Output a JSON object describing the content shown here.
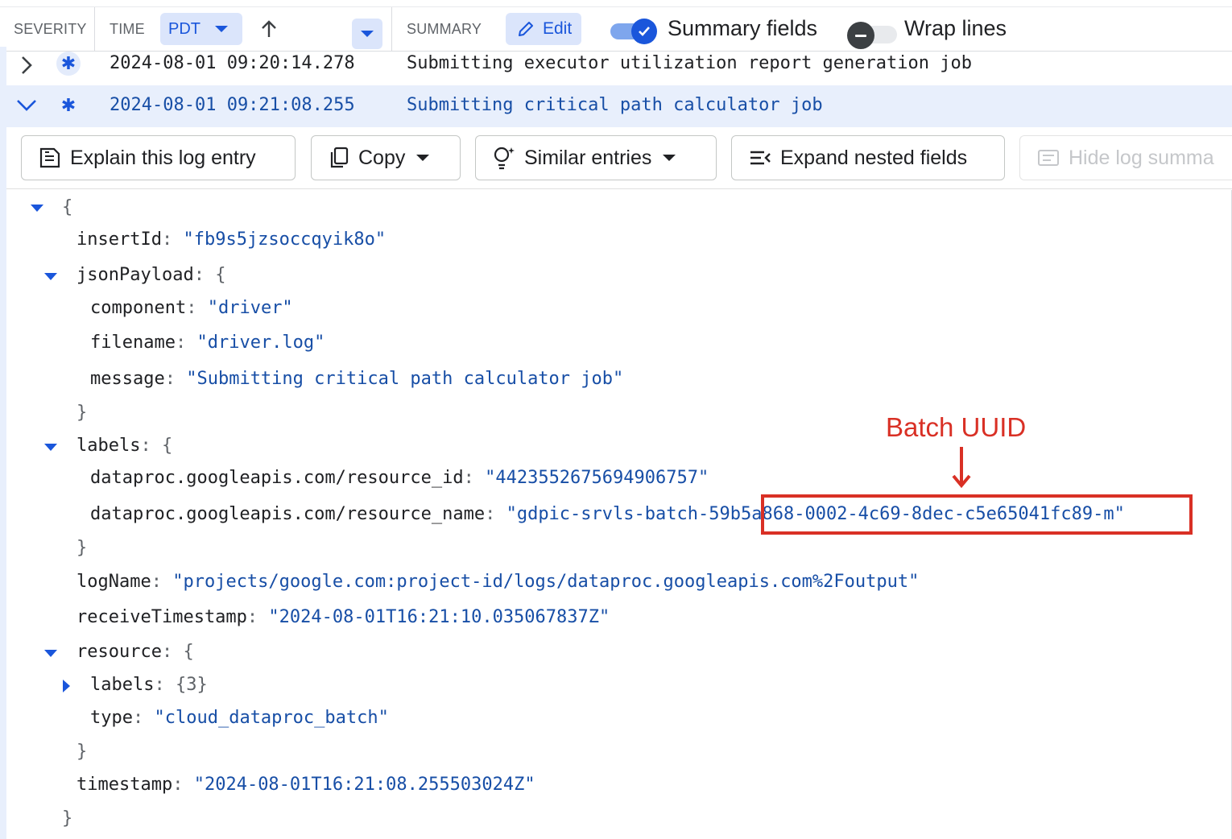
{
  "header": {
    "severity": "SEVERITY",
    "time": "TIME",
    "timezone": "PDT",
    "summary": "SUMMARY",
    "edit": "Edit",
    "summary_fields": "Summary fields",
    "wrap_lines": "Wrap lines",
    "summary_fields_on": true,
    "wrap_lines_on": false
  },
  "rows": [
    {
      "timestamp": "2024-08-01 09:20:14.278",
      "message": "Submitting executor utilization report generation job",
      "severity_icon": "asterisk-icon",
      "expanded": false
    },
    {
      "timestamp": "2024-08-01 09:21:08.255",
      "message": "Submitting critical path calculator job",
      "severity_icon": "asterisk-icon",
      "expanded": true
    }
  ],
  "toolbar": {
    "explain": "Explain this log entry",
    "copy": "Copy",
    "similar": "Similar entries",
    "expand": "Expand nested fields",
    "hide": "Hide log summa"
  },
  "json": {
    "open": "{",
    "close": "}",
    "insertId_key": "insertId",
    "insertId_val": "\"fb9s5jzsoccqyik8o\"",
    "jsonPayload_key": "jsonPayload",
    "component_key": "component",
    "component_val": "\"driver\"",
    "filename_key": "filename",
    "filename_val": "\"driver.log\"",
    "message_key": "message",
    "message_val": "\"Submitting critical path calculator job\"",
    "labels_key": "labels",
    "resource_id_key": "dataproc.googleapis.com/resource_id",
    "resource_id_val": "\"4423552675694906757\"",
    "resource_name_key": "dataproc.googleapis.com/resource_name",
    "resource_name_prefix": "\"gdpic-srvls-batch-",
    "resource_name_uuid": "59b5a868-0002-4c69-8dec-c5e65041fc89",
    "resource_name_suffix": "-m\"",
    "logName_key": "logName",
    "logName_val": "\"projects/google.com:project-id/logs/dataproc.googleapis.com%2Foutput\"",
    "receiveTimestamp_key": "receiveTimestamp",
    "receiveTimestamp_val": "\"2024-08-01T16:21:10.035067837Z\"",
    "resource_key": "resource",
    "resource_labels_key": "labels",
    "resource_labels_val": "{3}",
    "type_key": "type",
    "type_val": "\"cloud_dataproc_batch\"",
    "timestamp_key": "timestamp",
    "timestamp_val": "\"2024-08-01T16:21:08.255503024Z\""
  },
  "annotation": {
    "label": "Batch UUID",
    "color": "#d93025"
  },
  "colors": {
    "accent": "#1a56db",
    "selected_row": "#e8effc",
    "string_value": "#174ea6"
  }
}
